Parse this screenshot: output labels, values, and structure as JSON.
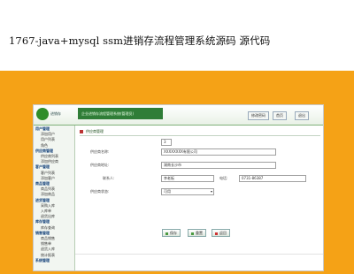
{
  "banner": {
    "title": "1767-java+mysql ssm进销存流程管理系统源码 源代码"
  },
  "header": {
    "logo_text": "进销存",
    "app_name": "企业进销存流程管理系统(管理员)",
    "toolbar": [
      {
        "label": "修改密码"
      },
      {
        "label": "首页"
      },
      {
        "label": "退出"
      }
    ]
  },
  "sidebar": {
    "items": [
      {
        "label": "用户管理",
        "type": "group"
      },
      {
        "label": "添加用户",
        "type": "child"
      },
      {
        "label": "用户列表",
        "type": "child"
      },
      {
        "label": "角色",
        "type": "child"
      },
      {
        "label": "供应商管理",
        "type": "group"
      },
      {
        "label": "供应商列表",
        "type": "child"
      },
      {
        "label": "添加供应商",
        "type": "child"
      },
      {
        "label": "客户管理",
        "type": "group"
      },
      {
        "label": "客户列表",
        "type": "child"
      },
      {
        "label": "添加客户",
        "type": "child"
      },
      {
        "label": "商品管理",
        "type": "group"
      },
      {
        "label": "商品列表",
        "type": "child"
      },
      {
        "label": "添加商品",
        "type": "child"
      },
      {
        "label": "进货管理",
        "type": "group"
      },
      {
        "label": "采购入库",
        "type": "child"
      },
      {
        "label": "入库单",
        "type": "child"
      },
      {
        "label": "退货出库",
        "type": "child"
      },
      {
        "label": "库存管理",
        "type": "group"
      },
      {
        "label": "库存查询",
        "type": "child"
      },
      {
        "label": "销售管理",
        "type": "group"
      },
      {
        "label": "商品销售",
        "type": "child"
      },
      {
        "label": "销售单",
        "type": "child"
      },
      {
        "label": "退货入库",
        "type": "child"
      },
      {
        "label": "统计报表",
        "type": "child"
      },
      {
        "label": "系统管理",
        "type": "group"
      }
    ]
  },
  "main": {
    "breadcrumb": "供应商管理",
    "form": {
      "code_value": "3",
      "name_label": "供应商名称:",
      "name_value": "XXXXXXXX有限公司",
      "address_label": "供应商地址:",
      "address_value": "湖南长沙市",
      "contact_label": "联系人:",
      "contact_value": "李老板",
      "phone_label": "电话:",
      "phone_value": "0731-86387",
      "status_label": "供应商状态:",
      "status_value": "可用"
    },
    "buttons": [
      {
        "label": "保存"
      },
      {
        "label": "重置"
      },
      {
        "label": "返回"
      }
    ]
  }
}
